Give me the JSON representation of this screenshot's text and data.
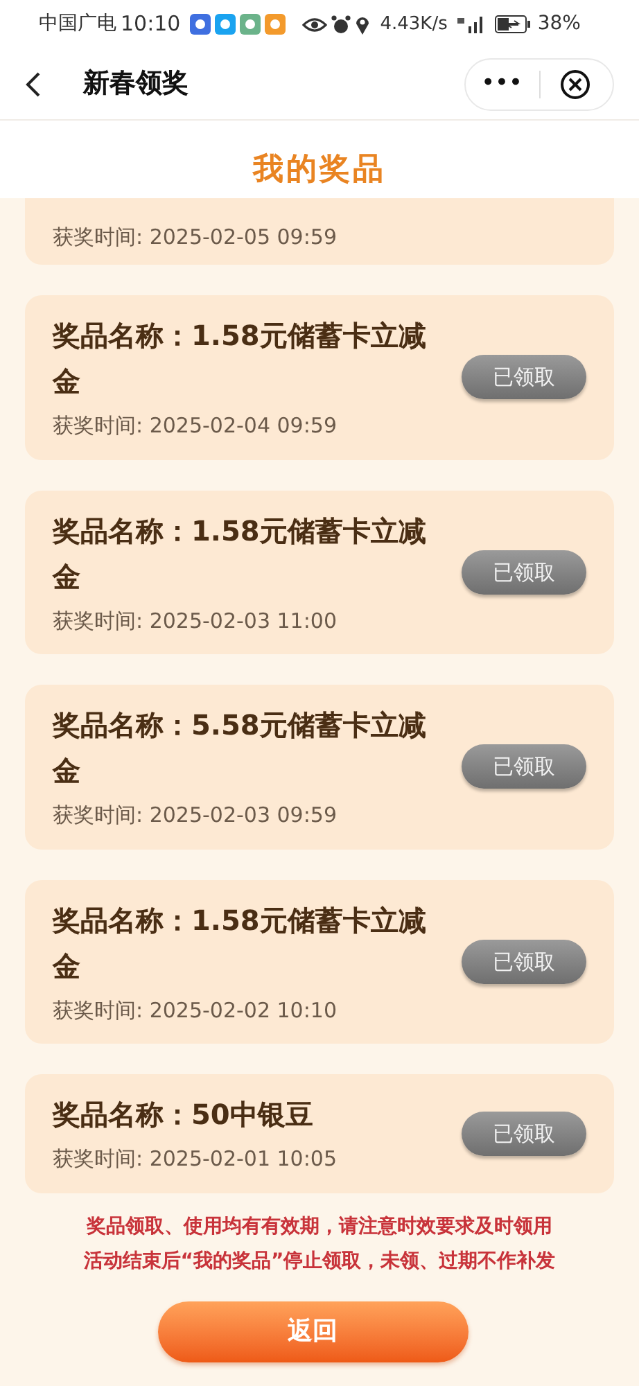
{
  "status_bar": {
    "carrier": "中国广电",
    "time": "10:10",
    "speed": "4.43K/s",
    "battery": "38%"
  },
  "nav": {
    "title": "新春领奖",
    "more": "•••"
  },
  "heading": "我的奖品",
  "prizes": [
    {
      "kind": "partial",
      "time": "获奖时间: 2025-02-05 09:59"
    },
    {
      "kind": "full",
      "name": "奖品名称：1.58元储蓄卡立减金",
      "time": "获奖时间: 2025-02-04 09:59",
      "button": "已领取",
      "claimed": true
    },
    {
      "kind": "full",
      "name": "奖品名称：1.58元储蓄卡立减金",
      "time": "获奖时间: 2025-02-03 11:00",
      "button": "已领取",
      "claimed": true
    },
    {
      "kind": "full",
      "name": "奖品名称：5.58元储蓄卡立减金",
      "time": "获奖时间: 2025-02-03 09:59",
      "button": "已领取",
      "claimed": true
    },
    {
      "kind": "full",
      "name": "奖品名称：1.58元储蓄卡立减金",
      "time": "获奖时间: 2025-02-02 10:10",
      "button": "已领取",
      "claimed": true
    },
    {
      "kind": "full",
      "name": "奖品名称：50中银豆",
      "time": "获奖时间: 2025-02-01 10:05",
      "button": "已领取",
      "claimed": true
    }
  ],
  "notes": [
    "奖品领取、使用均有有效期，请注意时效要求及时领用",
    "活动结束后“我的奖品”停止领取，未领、过期不作补发"
  ],
  "back_button": "返回"
}
